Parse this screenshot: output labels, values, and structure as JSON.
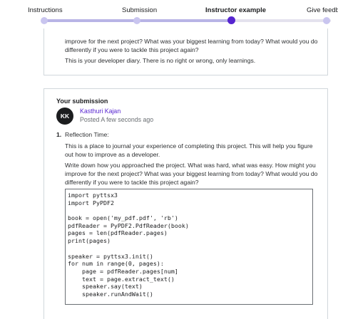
{
  "stepper": {
    "steps": [
      {
        "label": "Instructions"
      },
      {
        "label": "Submission"
      },
      {
        "label": "Instructor example"
      },
      {
        "label": "Give feedba"
      }
    ],
    "active_step": 2
  },
  "prev_card": {
    "lines": [
      "improve for the next project? What was your biggest learning from today? What would you do",
      "differently if you were to tackle this project again?",
      "This is your developer diary. There is no right or wrong, only learnings."
    ]
  },
  "submission": {
    "title": "Your submission",
    "avatar_initials": "KK",
    "author": "Kasthuri Kajan",
    "posted": "Posted A few seconds ago",
    "question": {
      "number": "1.",
      "heading": "Reflection Time:",
      "para1": [
        "This is a place to journal your experience of completing this project. This will help you figure",
        "out how to improve as a developer."
      ],
      "para2": [
        "Write down how you approached the project. What was hard, what was easy. How might you",
        "improve for the next project? What was your biggest learning from today? What would you do",
        "differently if you were to tackle this project again?"
      ]
    },
    "code_lines": [
      "import pyttsx3",
      "import PyPDF2",
      "",
      "book = open('my_pdf.pdf', 'rb')",
      "pdfReader = PyPDF2.PdfReader(book)",
      "pages = len(pdfReader.pages)",
      "print(pages)",
      "",
      "speaker = pyttsx3.init()",
      "for num in range(0, pages):",
      "    page = pdfReader.pages[num]",
      "    text = page.extract_text()",
      "    speaker.say(text)",
      "    speaker.runAndWait()"
    ]
  },
  "colors": {
    "accent": "#5624d0",
    "border": "#d1d7dc",
    "text": "#1c1d1f",
    "muted": "#6a6f73"
  }
}
